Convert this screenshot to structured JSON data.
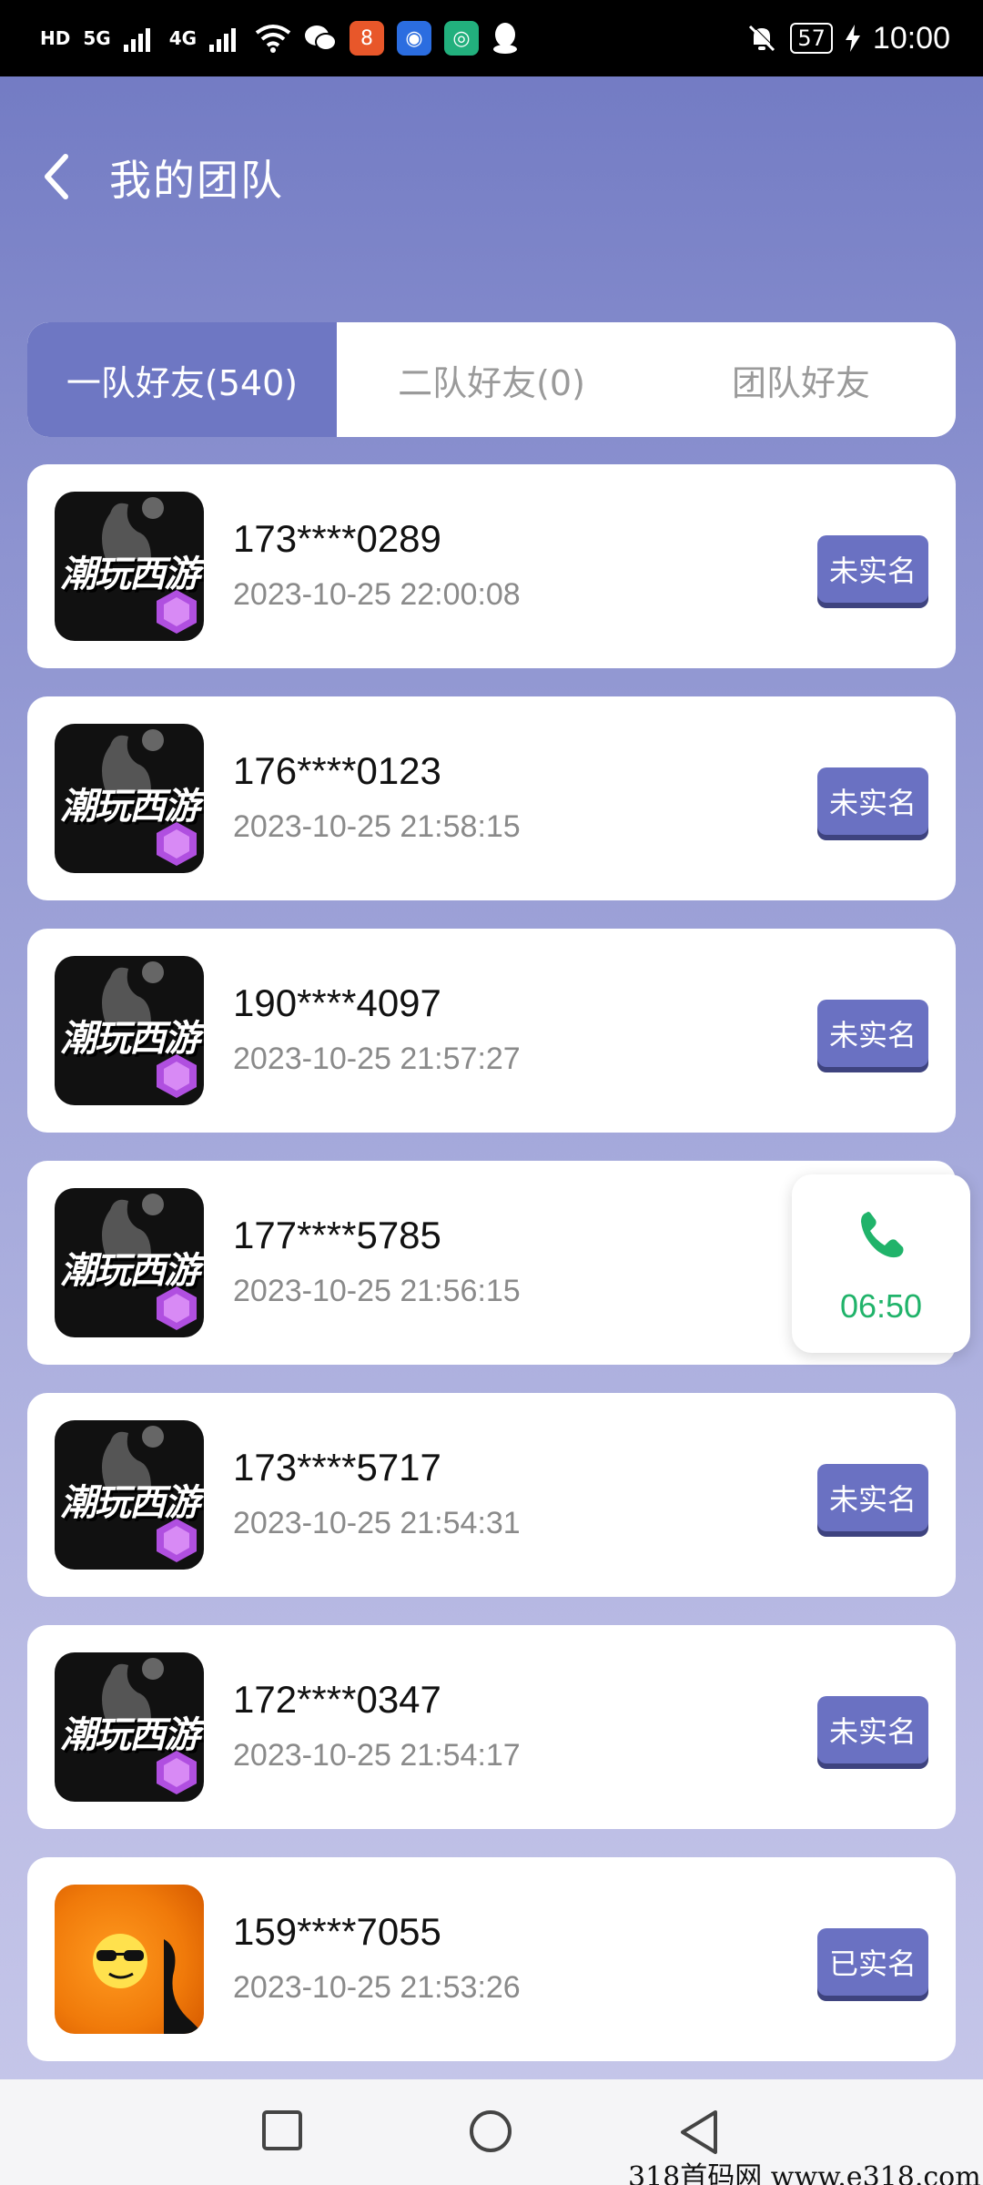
{
  "status_bar": {
    "left_labels": [
      "HD",
      "5G",
      "4G"
    ],
    "battery": "57",
    "time": "10:00"
  },
  "header": {
    "title": "我的团队"
  },
  "tabs": [
    {
      "label": "一队好友(540)",
      "active": true
    },
    {
      "label": "二队好友(0)",
      "active": false
    },
    {
      "label": "团队好友",
      "active": false
    }
  ],
  "avatar_logo_text": "潮玩西游",
  "members": [
    {
      "phone": "173****0289",
      "datetime": "2023-10-25 22:00:08",
      "status": "未实名",
      "avatar": "game"
    },
    {
      "phone": "176****0123",
      "datetime": "2023-10-25 21:58:15",
      "status": "未实名",
      "avatar": "game"
    },
    {
      "phone": "190****4097",
      "datetime": "2023-10-25 21:57:27",
      "status": "未实名",
      "avatar": "game"
    },
    {
      "phone": "177****5785",
      "datetime": "2023-10-25 21:56:15",
      "status": "",
      "avatar": "game"
    },
    {
      "phone": "173****5717",
      "datetime": "2023-10-25 21:54:31",
      "status": "未实名",
      "avatar": "game"
    },
    {
      "phone": "172****0347",
      "datetime": "2023-10-25 21:54:17",
      "status": "未实名",
      "avatar": "game"
    },
    {
      "phone": "159****7055",
      "datetime": "2023-10-25 21:53:26",
      "status": "已实名",
      "avatar": "emoji"
    }
  ],
  "call_widget": {
    "time": "06:50",
    "icon": "phone-icon"
  },
  "nav": {
    "icons": [
      "square-recent-icon",
      "circle-home-icon",
      "triangle-back-icon"
    ]
  },
  "watermark": "318首码网  www.e318.com",
  "colors": {
    "accent": "#6e77c3",
    "call_green": "#20b36a"
  }
}
